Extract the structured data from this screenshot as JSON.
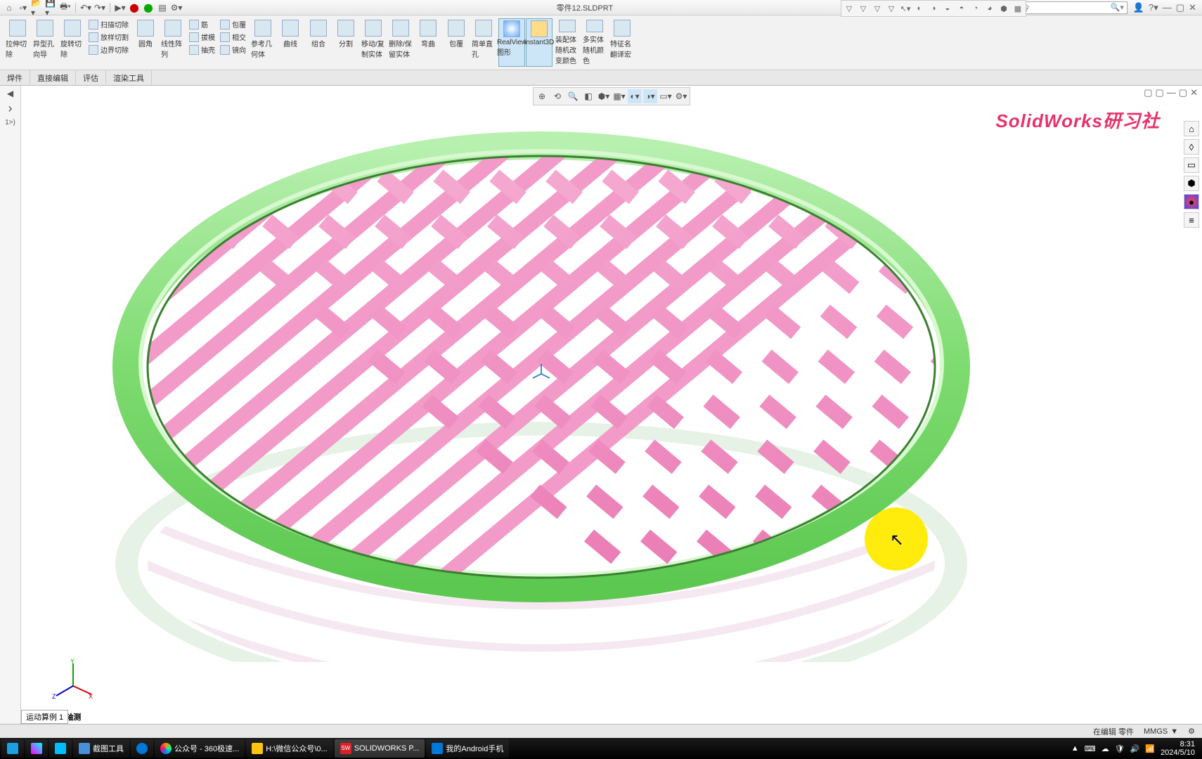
{
  "app": {
    "doc_title": "零件12.SLDPRT",
    "search_placeholder": "搜索命令",
    "watermark": "SolidWorks研习社"
  },
  "qat_icons": [
    "home",
    "new",
    "open",
    "save",
    "print",
    "undo",
    "redo",
    "select",
    "record",
    "rebuild",
    "settings"
  ],
  "ribbon_big": [
    {
      "label": "拉伸切\n除"
    },
    {
      "label": "异型孔\n向导"
    },
    {
      "label": "旋转切\n除"
    }
  ],
  "ribbon_small1": [
    "扫描切除",
    "放样切割",
    "边界切除"
  ],
  "ribbon_big2": [
    {
      "label": "圆角"
    },
    {
      "label": "线性阵\n列"
    }
  ],
  "ribbon_small2": [
    "筋",
    "拔模",
    "抽壳",
    "包覆",
    "相交",
    "镜向"
  ],
  "ribbon_big3": [
    {
      "label": "参考几\n何体"
    },
    {
      "label": "曲线"
    }
  ],
  "ribbon_big4": [
    {
      "label": "组合"
    },
    {
      "label": "分割"
    },
    {
      "label": "移动/复\n制实体"
    },
    {
      "label": "删除/保\n留实体"
    },
    {
      "label": "弯曲"
    }
  ],
  "ribbon_big5": [
    {
      "label": "包覆"
    },
    {
      "label": "简单直\n孔"
    }
  ],
  "ribbon_big6": [
    {
      "label": "RealView\n图形",
      "active": true
    },
    {
      "label": "Instant3D",
      "active": true
    }
  ],
  "ribbon_big7": [
    {
      "label": "装配体\n随机改\n变颜色"
    },
    {
      "label": "多实体\n随机颜\n色"
    },
    {
      "label": "特征名\n翻译宏"
    }
  ],
  "subtabs": [
    {
      "label": "焊件"
    },
    {
      "label": "直接编辑"
    },
    {
      "label": "评估"
    },
    {
      "label": "渲染工具"
    }
  ],
  "feature_panel": {
    "expand": "▶",
    "text": "1>)"
  },
  "viewport_toolbar": [
    "◎",
    "⟲",
    "🔍",
    "⚙",
    "✎",
    "□",
    "▦",
    "◐",
    "◑",
    "◒",
    "◓",
    "▼"
  ],
  "viewport_doc_controls": [
    "▢",
    "▢",
    "—",
    "□",
    "×"
  ],
  "side_icons": [
    "⌂",
    "◊",
    "▭",
    "⬢",
    "●",
    "≡"
  ],
  "triad_label": "*等轴测",
  "history_tab": "运动算例 1",
  "statusbar": {
    "edit": "在编辑 零件",
    "units": "MMGS",
    "arrow": "▼",
    "gear": "⚙"
  },
  "taskbar": [
    {
      "label": "",
      "color": "#1ba1e2"
    },
    {
      "label": "",
      "color": "#ff00ff"
    },
    {
      "label": "",
      "color": "#00bfff"
    },
    {
      "label": "截图工具",
      "color": "#4a90d9"
    },
    {
      "label": "",
      "color": "#0078d7"
    },
    {
      "label": "公众号 - 360极速...",
      "color": "#ff6a00"
    },
    {
      "label": "H:\\微信公众号\\0...",
      "color": "#ffc40d"
    },
    {
      "label": "SOLIDWORKS P...",
      "color": "#da2128",
      "active": true
    },
    {
      "label": "我的Android手机",
      "color": "#0078d7"
    }
  ],
  "tray": {
    "time": "8:31",
    "date": "2024/5/10"
  }
}
